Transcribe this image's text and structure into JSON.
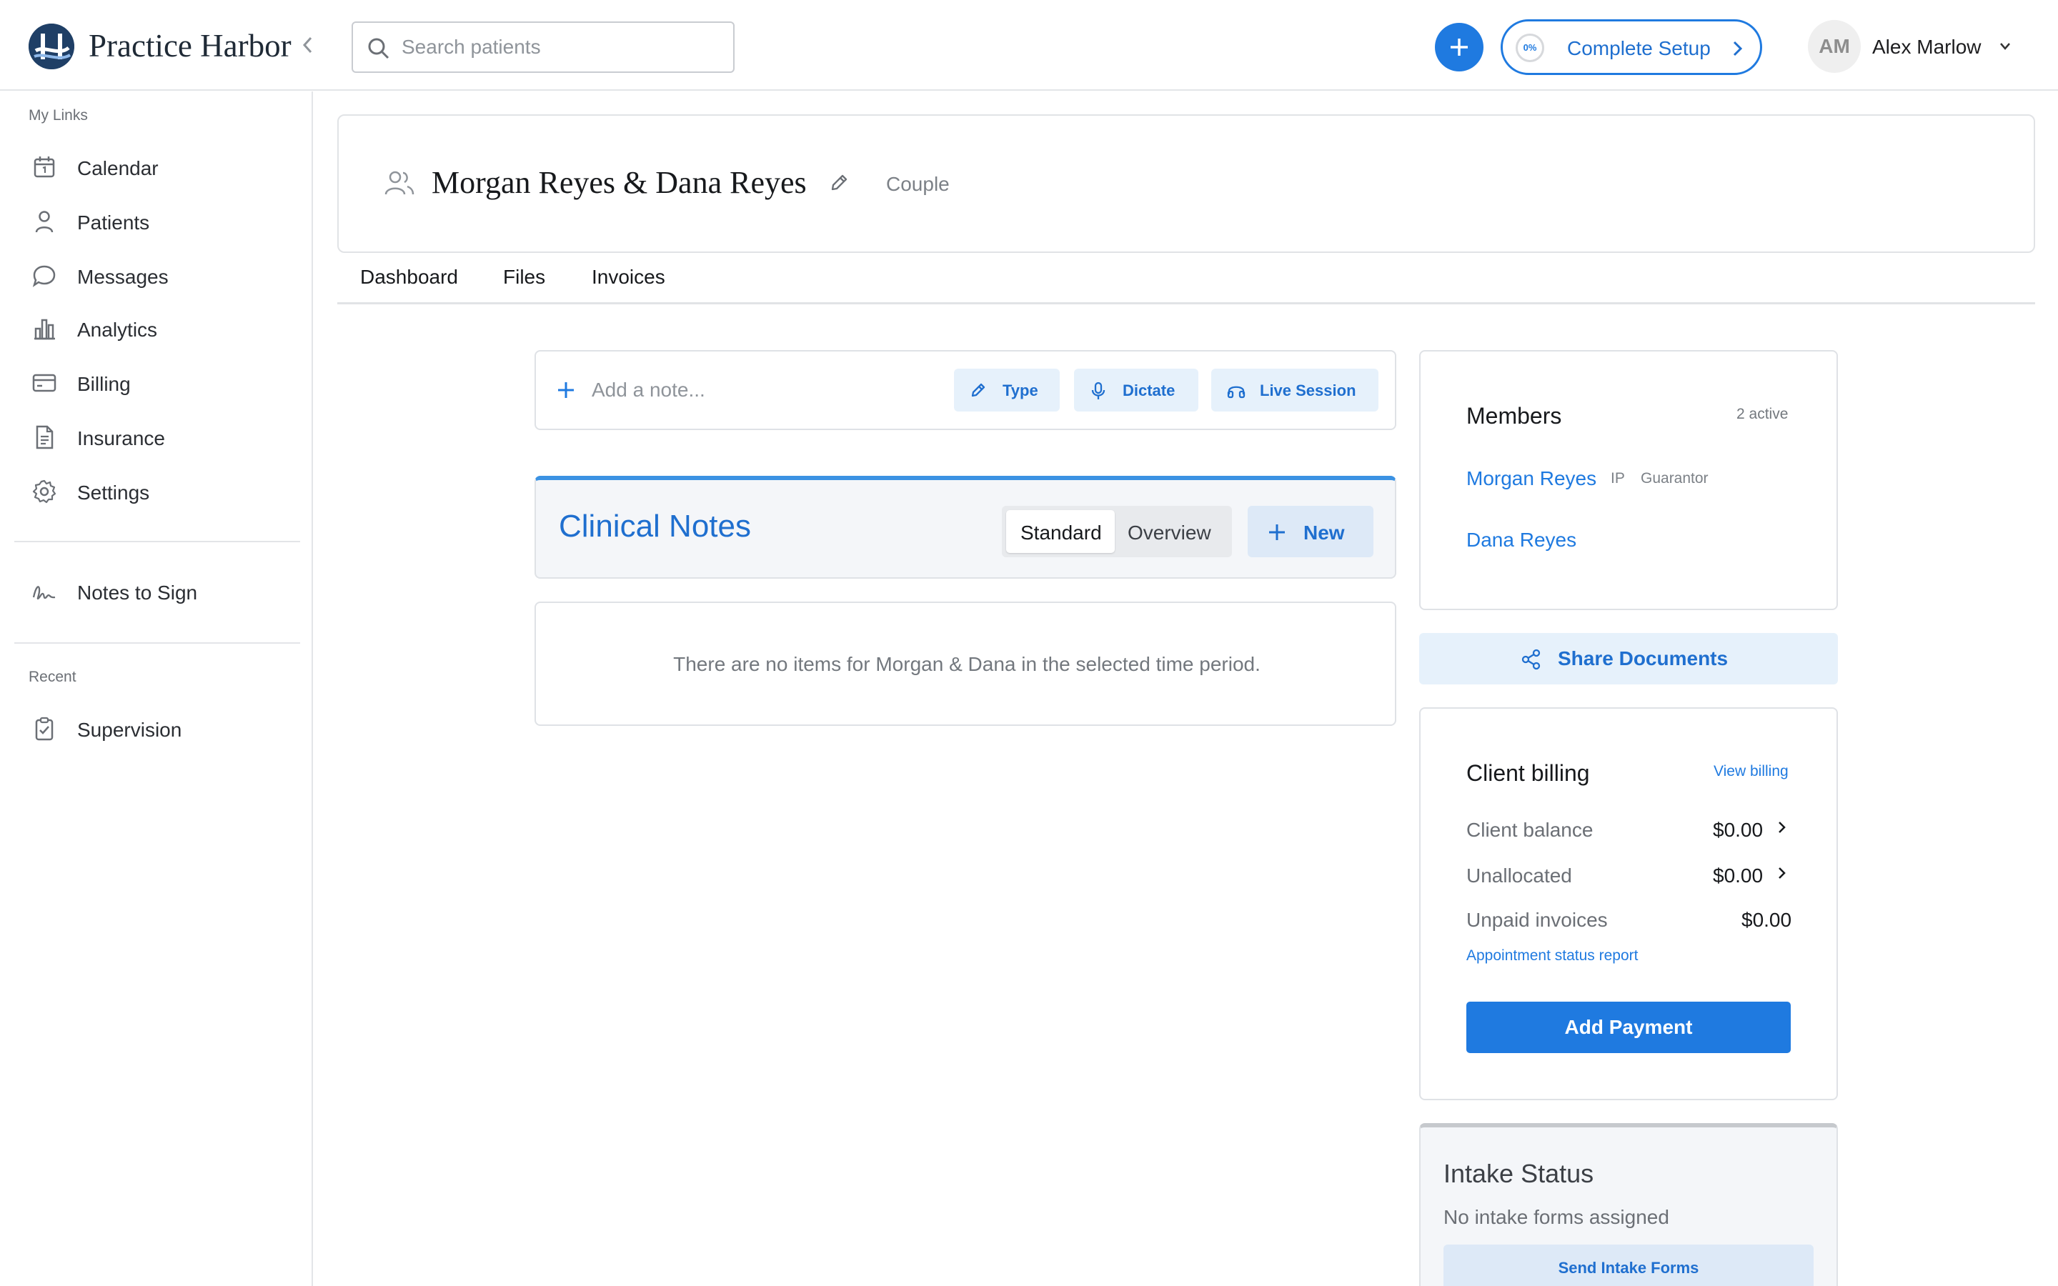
{
  "app": {
    "brand": "Practice Harbor"
  },
  "header": {
    "search_placeholder": "Search patients",
    "setup_progress_label": "0%",
    "setup_progress": 0,
    "setup_label": "Complete Setup",
    "avatar_initials": "AM",
    "user_name": "Alex Marlow"
  },
  "sidebar": {
    "my_links_heading": "My Links",
    "items": [
      {
        "label": "Calendar",
        "icon": "calendar-icon"
      },
      {
        "label": "Patients",
        "icon": "person-icon"
      },
      {
        "label": "Messages",
        "icon": "chat-bubble-icon"
      },
      {
        "label": "Analytics",
        "icon": "bar-chart-icon"
      },
      {
        "label": "Billing",
        "icon": "credit-card-icon"
      },
      {
        "label": "Insurance",
        "icon": "document-icon"
      },
      {
        "label": "Settings",
        "icon": "gear-icon"
      }
    ],
    "notes_to_sign": {
      "label": "Notes to Sign",
      "icon": "signature-icon"
    },
    "recent_heading": "Recent",
    "recent_items": [
      {
        "label": "Supervision",
        "icon": "clipboard-check-icon"
      }
    ]
  },
  "client": {
    "name": "Morgan Reyes & Dana Reyes",
    "type": "Couple"
  },
  "tabs": [
    {
      "label": "Dashboard"
    },
    {
      "label": "Files"
    },
    {
      "label": "Invoices"
    }
  ],
  "note_bar": {
    "placeholder": "Add a note...",
    "type_label": "Type",
    "dictate_label": "Dictate",
    "live_session_label": "Live Session"
  },
  "clinical_notes": {
    "title": "Clinical Notes",
    "view_standard": "Standard",
    "view_overview": "Overview",
    "new_label": "New",
    "empty_message": "There are no items for Morgan & Dana in the selected time period."
  },
  "members": {
    "title": "Members",
    "count": "2 active",
    "list": [
      {
        "name": "Morgan Reyes",
        "tag_ip": "IP",
        "tag_role": "Guarantor"
      },
      {
        "name": "Dana Reyes"
      }
    ]
  },
  "share_documents": {
    "label": "Share Documents"
  },
  "billing": {
    "title": "Client billing",
    "view_link": "View billing",
    "rows": [
      {
        "label": "Client balance",
        "value": "$0.00"
      },
      {
        "label": "Unallocated",
        "value": "$0.00"
      },
      {
        "label": "Unpaid invoices",
        "value": "$0.00"
      }
    ],
    "report_link": "Appointment status report",
    "add_payment_label": "Add Payment"
  },
  "intake": {
    "title": "Intake Status",
    "subtitle": "No intake forms assigned",
    "button_label": "Send Intake Forms"
  },
  "colors": {
    "accent": "#1f7ae0",
    "brand_navy": "#1f3f66",
    "light_accent": "#e6f1fb"
  }
}
